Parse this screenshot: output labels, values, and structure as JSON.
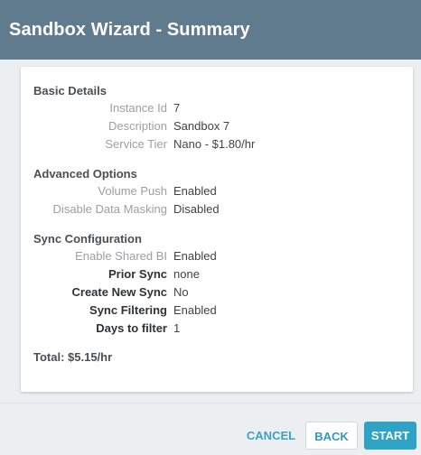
{
  "header": {
    "title": "Sandbox Wizard - Summary"
  },
  "basic_details": {
    "title": "Basic Details",
    "rows": [
      {
        "label": "Instance Id",
        "value": "7"
      },
      {
        "label": "Description",
        "value": "Sandbox 7"
      },
      {
        "label": "Service Tier",
        "value": "Nano - $1.80/hr"
      }
    ]
  },
  "advanced_options": {
    "title": "Advanced Options",
    "rows": [
      {
        "label": "Volume Push",
        "value": "Enabled"
      },
      {
        "label": "Disable Data Masking",
        "value": "Disabled"
      }
    ]
  },
  "sync_configuration": {
    "title": "Sync Configuration",
    "rows": [
      {
        "label": "Enable Shared BI",
        "value": "Enabled"
      },
      {
        "label": "Prior Sync",
        "value": "none"
      },
      {
        "label": "Create New Sync",
        "value": "No"
      },
      {
        "label": "Sync Filtering",
        "value": "Enabled"
      },
      {
        "label": "Days to filter",
        "value": "1"
      }
    ]
  },
  "total": "Total: $5.15/hr",
  "footer": {
    "cancel_label": "CANCEL",
    "back_label": "BACK",
    "start_label": "START"
  },
  "colors": {
    "header_bg": "#5f7b8d",
    "accent": "#2ea3c6"
  }
}
